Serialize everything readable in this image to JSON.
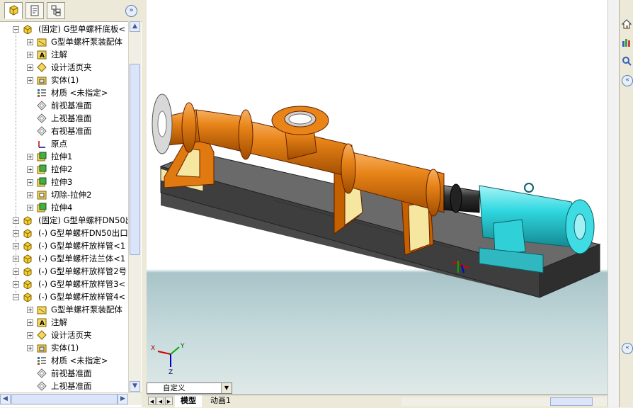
{
  "feature_tree": {
    "rows": [
      {
        "label": "(固定) G型单螺杆底板<",
        "icon": "part-icon",
        "depth": 1,
        "expander": "minus"
      },
      {
        "label": "G型单螺杆泵装配体",
        "icon": "assembly-folder-icon",
        "depth": 2,
        "expander": "plus"
      },
      {
        "label": "注解",
        "icon": "annotation-icon",
        "depth": 2,
        "expander": "plus"
      },
      {
        "label": "设计活页夹",
        "icon": "design-binder-icon",
        "depth": 2,
        "expander": "plus"
      },
      {
        "label": "实体(1)",
        "icon": "solid-body-folder-icon",
        "depth": 2,
        "expander": "plus"
      },
      {
        "label": "材质 <未指定>",
        "icon": "material-icon",
        "depth": 2,
        "expander": "none"
      },
      {
        "label": "前视基准面",
        "icon": "plane-icon",
        "depth": 2,
        "expander": "none"
      },
      {
        "label": "上视基准面",
        "icon": "plane-icon",
        "depth": 2,
        "expander": "none"
      },
      {
        "label": "右视基准面",
        "icon": "plane-icon",
        "depth": 2,
        "expander": "none"
      },
      {
        "label": "原点",
        "icon": "origin-icon",
        "depth": 2,
        "expander": "none"
      },
      {
        "label": "拉伸1",
        "icon": "extrude-icon",
        "depth": 2,
        "expander": "plus"
      },
      {
        "label": "拉伸2",
        "icon": "extrude-icon",
        "depth": 2,
        "expander": "plus"
      },
      {
        "label": "拉伸3",
        "icon": "extrude-icon",
        "depth": 2,
        "expander": "plus"
      },
      {
        "label": "切除-拉伸2",
        "icon": "cut-extrude-icon",
        "depth": 2,
        "expander": "plus"
      },
      {
        "label": "拉伸4",
        "icon": "extrude-icon",
        "depth": 2,
        "expander": "plus"
      },
      {
        "label": "(固定) G型单螺杆DN50出",
        "icon": "part-icon",
        "depth": 1,
        "expander": "plus"
      },
      {
        "label": "(-) G型单螺杆DN50出口",
        "icon": "part-icon",
        "depth": 1,
        "expander": "plus"
      },
      {
        "label": "(-) G型单螺杆放样管<1",
        "icon": "part-icon",
        "depth": 1,
        "expander": "plus"
      },
      {
        "label": "(-) G型单螺杆法兰体<1",
        "icon": "part-icon",
        "depth": 1,
        "expander": "plus"
      },
      {
        "label": "(-) G型单螺杆放样管2号",
        "icon": "part-icon",
        "depth": 1,
        "expander": "plus"
      },
      {
        "label": "(-) G型单螺杆放样管3<",
        "icon": "part-icon",
        "depth": 1,
        "expander": "plus"
      },
      {
        "label": "(-) G型单螺杆放样管4<",
        "icon": "part-icon",
        "depth": 1,
        "expander": "minus"
      },
      {
        "label": "G型单螺杆泵装配体",
        "icon": "assembly-folder-icon",
        "depth": 2,
        "expander": "plus"
      },
      {
        "label": "注解",
        "icon": "annotation-icon",
        "depth": 2,
        "expander": "plus"
      },
      {
        "label": "设计活页夹",
        "icon": "design-binder-icon",
        "depth": 2,
        "expander": "plus"
      },
      {
        "label": "实体(1)",
        "icon": "solid-body-folder-icon",
        "depth": 2,
        "expander": "plus"
      },
      {
        "label": "材质 <未指定>",
        "icon": "material-icon",
        "depth": 2,
        "expander": "none"
      },
      {
        "label": "前视基准面",
        "icon": "plane-icon",
        "depth": 2,
        "expander": "none"
      },
      {
        "label": "上视基准面",
        "icon": "plane-icon",
        "depth": 2,
        "expander": "none"
      }
    ]
  },
  "viewport": {
    "view_orientation": "自定义",
    "triad": {
      "x": "X",
      "y": "Y",
      "z": "Z"
    }
  },
  "bottom_tabs": [
    {
      "label": "模型",
      "active": true
    },
    {
      "label": "动画1",
      "active": false
    }
  ],
  "colors": {
    "pump_body": "#e07a10",
    "motor": "#30d0d8",
    "base_plate": "#5a5a5a",
    "support_pad": "#f5e6a0"
  }
}
